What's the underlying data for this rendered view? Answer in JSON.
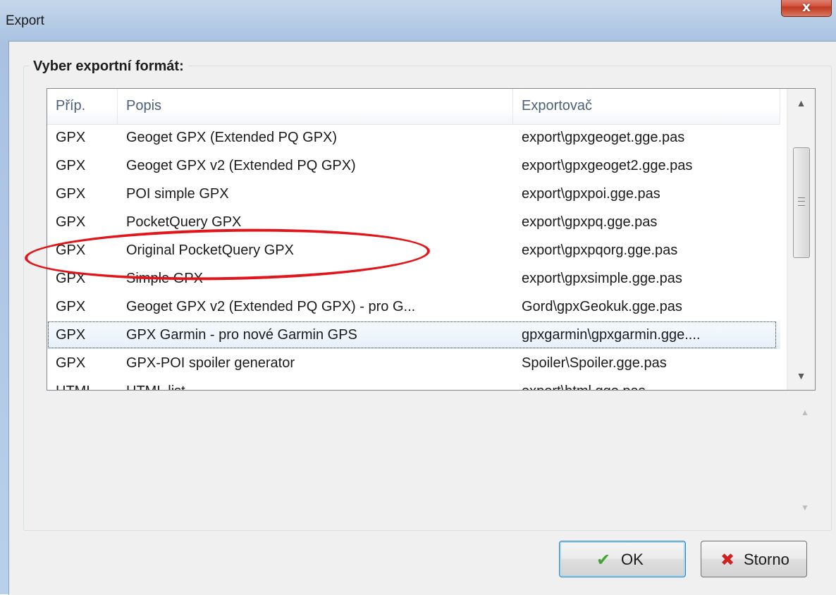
{
  "window": {
    "title": "Export",
    "close_label": "x"
  },
  "group": {
    "title": "Vyber exportní formát:"
  },
  "list": {
    "columns": [
      "Příp.",
      "Popis",
      "Exportovač"
    ],
    "rows": [
      {
        "ext": "GPX",
        "desc": "Geoget GPX (Extended PQ GPX)",
        "exporter": "export\\gpxgeoget.gge.pas"
      },
      {
        "ext": "GPX",
        "desc": "Geoget GPX v2 (Extended PQ GPX)",
        "exporter": "export\\gpxgeoget2.gge.pas"
      },
      {
        "ext": "GPX",
        "desc": "POI simple GPX",
        "exporter": "export\\gpxpoi.gge.pas"
      },
      {
        "ext": "GPX",
        "desc": "PocketQuery GPX",
        "exporter": "export\\gpxpq.gge.pas"
      },
      {
        "ext": "GPX",
        "desc": "Original PocketQuery GPX",
        "exporter": "export\\gpxpqorg.gge.pas"
      },
      {
        "ext": "GPX",
        "desc": "Simple GPX",
        "exporter": "export\\gpxsimple.gge.pas"
      },
      {
        "ext": "GPX",
        "desc": "Geoget GPX v2 (Extended PQ GPX) - pro G...",
        "exporter": "Gord\\gpxGeokuk.gge.pas"
      },
      {
        "ext": "GPX",
        "desc": "GPX Garmin - pro nové Garmin GPS",
        "exporter": "gpxgarmin\\gpxgarmin.gge...."
      },
      {
        "ext": "GPX",
        "desc": "GPX-POI spoiler generator",
        "exporter": "Spoiler\\Spoiler.gge.pas"
      },
      {
        "ext": "HTML",
        "desc": "HTML list",
        "exporter": "export\\html.gge.pas"
      }
    ],
    "selected_index": 7,
    "scroll_up_glyph": "▲",
    "scroll_down_glyph": "▼",
    "thumb_icon": "scroll-grip-icon"
  },
  "memo": {
    "scroll_up_glyph": "▲",
    "scroll_down_glyph": "▼"
  },
  "buttons": {
    "ok": {
      "label": "OK",
      "icon": "checkmark-icon",
      "glyph": "✔",
      "color": "#3fa62f"
    },
    "cancel": {
      "label": "Storno",
      "icon": "x-icon",
      "glyph": "✖",
      "color": "#d02020"
    }
  },
  "annotation": {
    "color": "#e2161a",
    "highlighted_row_index": 4
  }
}
